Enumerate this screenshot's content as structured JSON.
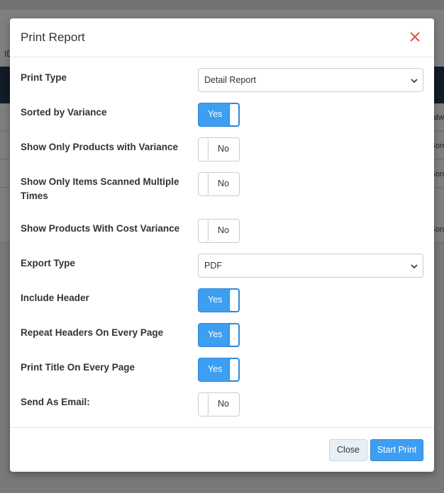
{
  "background": {
    "filter_label": "ID",
    "row_texts": [
      "latw",
      "Son",
      "Son",
      "",
      "Son"
    ]
  },
  "modal": {
    "title": "Print Report",
    "fields": [
      {
        "label": "Print Type",
        "type": "select",
        "value": "Detail Report"
      },
      {
        "label": "Sorted by Variance",
        "type": "toggle",
        "value": "Yes"
      },
      {
        "label": "Show Only Products with Variance",
        "type": "toggle",
        "value": "No"
      },
      {
        "label": "Show Only Items Scanned Multiple Times",
        "type": "toggle",
        "value": "No"
      },
      {
        "label": "Show Products With Cost Variance",
        "type": "toggle",
        "value": "No"
      },
      {
        "label": "Export Type",
        "type": "select",
        "value": "PDF"
      },
      {
        "label": "Include Header",
        "type": "toggle",
        "value": "Yes"
      },
      {
        "label": "Repeat Headers On Every Page",
        "type": "toggle",
        "value": "Yes"
      },
      {
        "label": "Print Title On Every Page",
        "type": "toggle",
        "value": "Yes"
      },
      {
        "label": "Send As Email:",
        "type": "toggle",
        "value": "No"
      }
    ],
    "footer": {
      "close_label": "Close",
      "start_label": "Start Print"
    }
  },
  "colors": {
    "accent": "#3d9ef2",
    "close_icon": "#e0504a",
    "table_header": "#24384f"
  }
}
